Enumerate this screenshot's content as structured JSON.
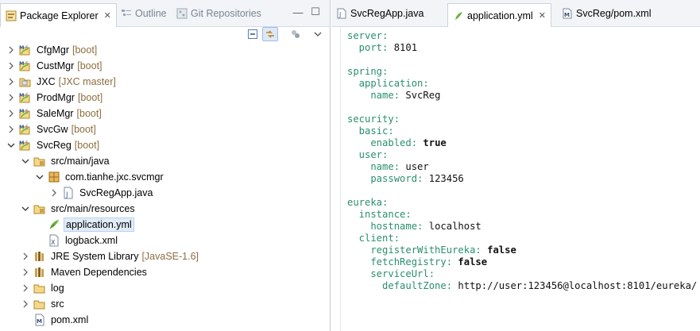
{
  "left_panel": {
    "tabs": [
      {
        "label": "Package Explorer",
        "icon": "package-explorer-icon",
        "active": true,
        "close": "✕"
      },
      {
        "label": "Outline",
        "icon": "outline-icon",
        "active": false
      },
      {
        "label": "Git Repositories",
        "icon": "git-repositories-icon",
        "active": false
      }
    ],
    "view_controls": {
      "minimize": "—",
      "maximize": "☐"
    },
    "toolbar": [
      "collapse-all-icon",
      "link-with-editor-icon",
      "view-options-icon",
      "view-menu-icon"
    ],
    "tree": [
      {
        "label": "CfgMgr",
        "decoration": "[boot]",
        "expander": "collapsed",
        "icon": "maven-project-icon"
      },
      {
        "label": "CustMgr",
        "decoration": "[boot]",
        "expander": "collapsed",
        "icon": "maven-project-icon"
      },
      {
        "label": "JXC",
        "decoration": "[JXC master]",
        "expander": "collapsed",
        "icon": "git-project-icon"
      },
      {
        "label": "ProdMgr",
        "decoration": "[boot]",
        "expander": "collapsed",
        "icon": "maven-project-icon"
      },
      {
        "label": "SaleMgr",
        "decoration": "[boot]",
        "expander": "collapsed",
        "icon": "maven-project-icon"
      },
      {
        "label": "SvcGw",
        "decoration": "[boot]",
        "expander": "collapsed",
        "icon": "maven-project-icon"
      },
      {
        "label": "SvcReg",
        "decoration": "[boot]",
        "expander": "expanded",
        "icon": "maven-project-icon"
      },
      {
        "label": "src/main/java",
        "decoration": "",
        "expander": "expanded",
        "icon": "source-folder-icon"
      },
      {
        "label": "com.tianhe.jxc.svcmgr",
        "decoration": "",
        "expander": "expanded",
        "icon": "package-icon"
      },
      {
        "label": "SvcRegApp.java",
        "decoration": "",
        "expander": "collapsed",
        "icon": "java-file-icon"
      },
      {
        "label": "src/main/resources",
        "decoration": "",
        "expander": "expanded",
        "icon": "source-folder-icon"
      },
      {
        "label": "application.yml",
        "decoration": "",
        "expander": "none",
        "icon": "yaml-file-icon",
        "selected": true
      },
      {
        "label": "logback.xml",
        "decoration": "",
        "expander": "none",
        "icon": "xml-file-icon"
      },
      {
        "label": "JRE System Library",
        "decoration": "[JavaSE-1.6]",
        "expander": "collapsed",
        "icon": "library-icon"
      },
      {
        "label": "Maven Dependencies",
        "decoration": "",
        "expander": "collapsed",
        "icon": "library-icon"
      },
      {
        "label": "log",
        "decoration": "",
        "expander": "collapsed",
        "icon": "folder-icon"
      },
      {
        "label": "src",
        "decoration": "",
        "expander": "collapsed",
        "icon": "folder-icon"
      },
      {
        "label": "pom.xml",
        "decoration": "",
        "expander": "none",
        "icon": "maven-pom-icon"
      }
    ]
  },
  "editor": {
    "tabs": [
      {
        "label": "SvcRegApp.java",
        "icon": "java-file-icon",
        "active": false
      },
      {
        "label": "application.yml",
        "icon": "yaml-file-icon",
        "active": true,
        "close": "✕"
      },
      {
        "label": "SvcReg/pom.xml",
        "icon": "maven-pom-icon",
        "active": false
      }
    ],
    "lines": [
      {
        "key": "server:",
        "value": ""
      },
      {
        "key": "  port:",
        "value": " 8101"
      },
      {
        "key": "",
        "value": ""
      },
      {
        "key": "spring:",
        "value": ""
      },
      {
        "key": "  application:",
        "value": ""
      },
      {
        "key": "    name:",
        "value": " SvcReg"
      },
      {
        "key": "",
        "value": ""
      },
      {
        "key": "security:",
        "value": ""
      },
      {
        "key": "  basic:",
        "value": ""
      },
      {
        "key": "    enabled:",
        "value": " true",
        "bold": true
      },
      {
        "key": "  user:",
        "value": ""
      },
      {
        "key": "    name:",
        "value": " user"
      },
      {
        "key": "    password:",
        "value": " 123456"
      },
      {
        "key": "",
        "value": ""
      },
      {
        "key": "eureka:",
        "value": ""
      },
      {
        "key": "  instance:",
        "value": ""
      },
      {
        "key": "    hostname:",
        "value": " localhost"
      },
      {
        "key": "  client:",
        "value": ""
      },
      {
        "key": "    registerWithEureka:",
        "value": " false",
        "bold": true
      },
      {
        "key": "    fetchRegistry:",
        "value": " false",
        "bold": true
      },
      {
        "key": "    serviceUrl:",
        "value": ""
      },
      {
        "key": "      defaultZone:",
        "value": " http://user:123456@localhost:8101/eureka/"
      }
    ]
  },
  "colors": {
    "yaml_key": "#2a8f6f",
    "selection": "#e1ecf9",
    "decoration": "#8d6e3f",
    "tab_bar": "#f2f4f7"
  }
}
